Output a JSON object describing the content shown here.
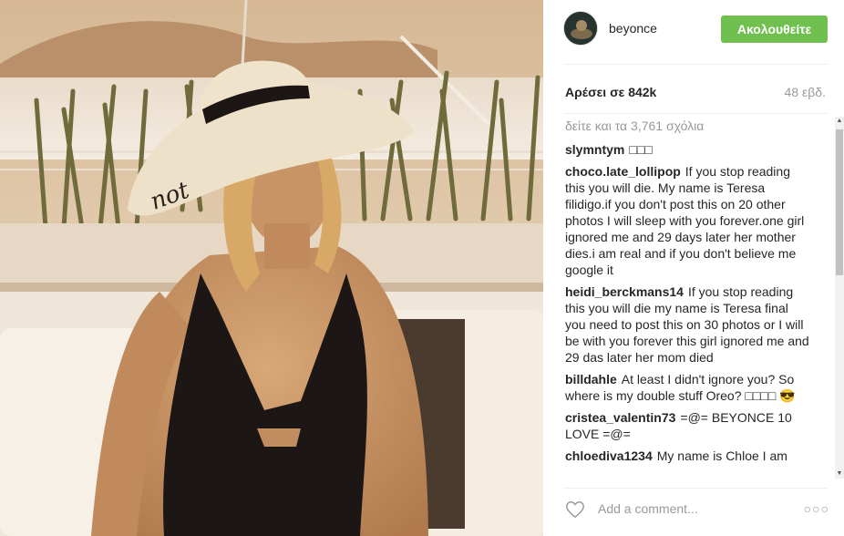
{
  "post": {
    "username": "beyonce",
    "follow_label": "Ακολουθείτε",
    "likes_text": "Αρέσει σε 842k",
    "age_text": "48 εβδ.",
    "more_comments_text": "δείτε και τα 3,761 σχόλια",
    "comments": [
      {
        "user": "slymntym",
        "text": "□□□"
      },
      {
        "user": "choco.late_lollipop",
        "text": "If you stop reading this you will die. My name is Teresa filidigo.if you don't post this on 20 other photos I will sleep with you forever.one girl ignored me and 29 days later her mother dies.i am real and if you don't believe me google it"
      },
      {
        "user": "heidi_berckmans14",
        "text": "If you stop reading this you will die my name is Teresa final you need to post this on 30 photos or I will be with you forever this girl ignored me and 29 das later her mom died"
      },
      {
        "user": "billdahle",
        "text": "At least I didn't ignore you? So where is my double stuff Oreo? □□□□ 😎"
      },
      {
        "user": "cristea_valentin73",
        "text": "=@= BEYONCE 10 LOVE =@="
      },
      {
        "user": "chloediva1234",
        "text": "My name is Chloe I am"
      }
    ],
    "add_comment_placeholder": "Add a comment...",
    "more_options": "○○○"
  },
  "icons": {
    "heart": "heart-icon",
    "avatar": "avatar",
    "options": "ellipsis-icon"
  },
  "colors": {
    "follow_button": "#70c050",
    "muted_text": "#999999"
  }
}
